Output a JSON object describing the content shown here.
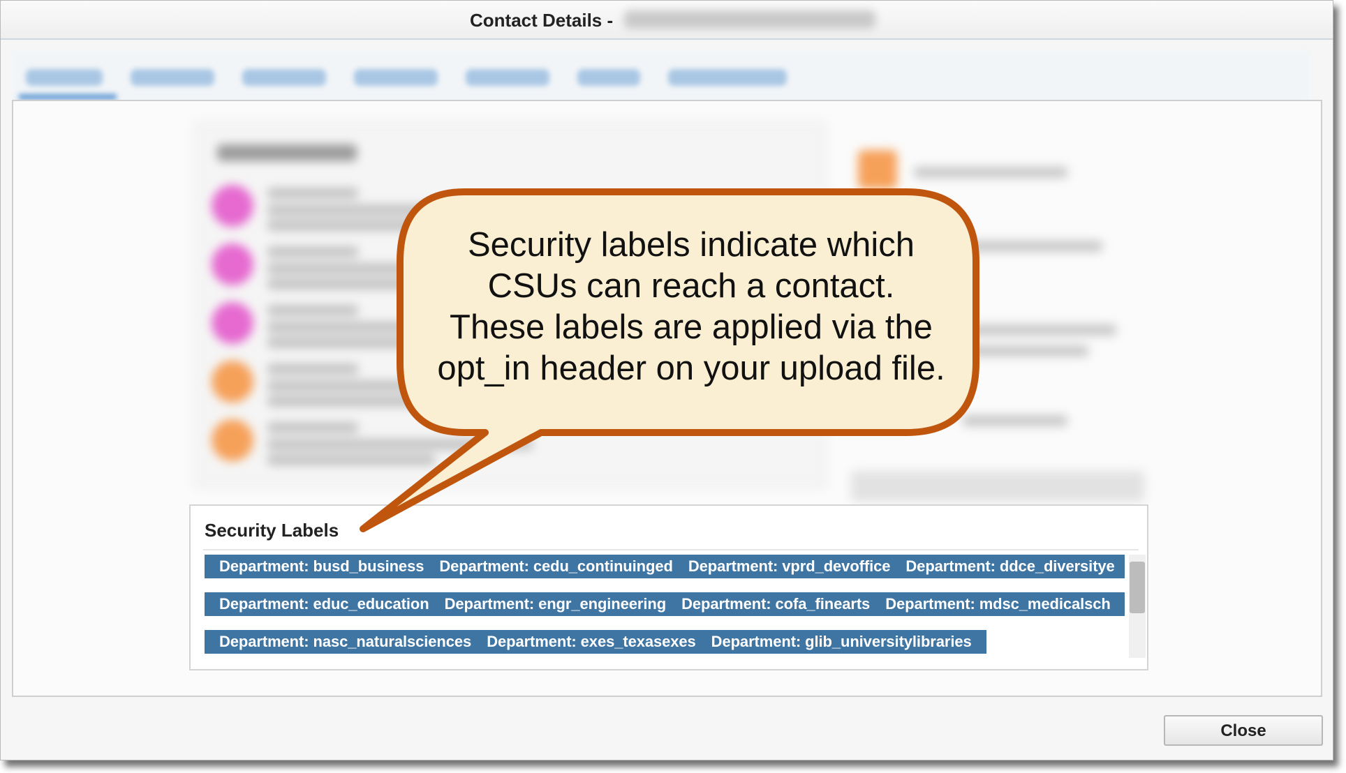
{
  "window": {
    "title": "Contact Details -"
  },
  "security_labels": {
    "heading": "Security Labels",
    "rows": [
      [
        "Department: busd_business",
        "Department: cedu_continuinged",
        "Department: vprd_devoffice",
        "Department: ddce_diversitye"
      ],
      [
        "Department: educ_education",
        "Department: engr_engineering",
        "Department: cofa_finearts",
        "Department: mdsc_medicalsch"
      ],
      [
        "Department: nasc_naturalsciences",
        "Department: exes_texasexes",
        "Department: glib_universitylibraries"
      ]
    ]
  },
  "callout": {
    "lines": [
      "Security labels indicate which",
      "CSUs can reach a contact.",
      "These labels are applied via the",
      "opt_in header on your upload file."
    ]
  },
  "footer": {
    "close_label": "Close"
  },
  "colors": {
    "label_chip_bg": "#3f75a3",
    "callout_fill": "#faefd2",
    "callout_border": "#c0560e"
  }
}
